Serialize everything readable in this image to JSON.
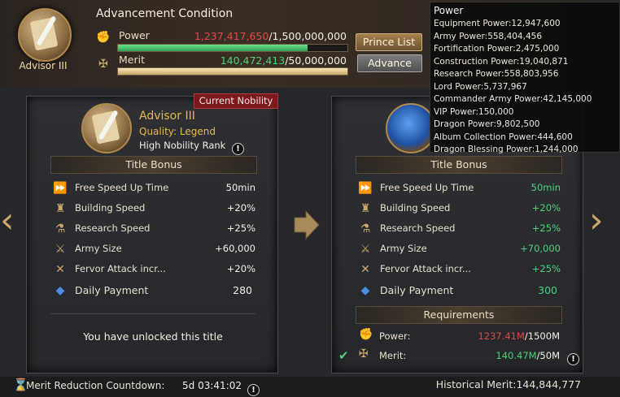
{
  "header": {
    "portrait_label": "Advisor III",
    "title": "Advancement Condition",
    "power": {
      "label": "Power",
      "current": "1,237,417,650",
      "required": "/1,500,000,000",
      "progress": 0.825
    },
    "merit": {
      "label": "Merit",
      "current": "140,472,413",
      "required": "/50,000,000",
      "progress": 1.0
    },
    "prince_list_button": "Prince List",
    "advance_button": "Advance"
  },
  "tooltip": {
    "title": "Power",
    "lines": [
      "Equipment Power:12,947,600",
      "Army Power:558,404,456",
      "Fortification Power:2,475,000",
      "Construction Power:19,040,871",
      "Research Power:558,803,956",
      "Lord Power:5,737,967",
      "Commander Army Power:42,145,000",
      "VIP Power:150,000",
      "Dragon Power:9,802,500",
      "Album Collection Power:444,600",
      "Dragon Blessing Power:1,244,000"
    ]
  },
  "left_card": {
    "badge": "Current Nobility",
    "name": "Advisor III",
    "quality": "Quality: Legend",
    "rank_note": "High Nobility Rank",
    "section_title": "Title Bonus",
    "bonuses": [
      {
        "icon": "speed-up-icon",
        "name": "Free Speed Up Time",
        "value": "50min"
      },
      {
        "icon": "building-icon",
        "name": "Building Speed",
        "value": "+20%"
      },
      {
        "icon": "research-icon",
        "name": "Research Speed",
        "value": "+25%"
      },
      {
        "icon": "army-icon",
        "name": "Army Size",
        "value": "+60,000"
      },
      {
        "icon": "swords-icon",
        "name": "Fervor Attack incr...",
        "value": "+20%"
      },
      {
        "icon": "gem-icon",
        "name": "Daily Payment",
        "value": "280"
      }
    ],
    "unlocked_text": "You have unlocked this title"
  },
  "right_card": {
    "section_title": "Title Bonus",
    "bonuses": [
      {
        "icon": "speed-up-icon",
        "name": "Free Speed Up Time",
        "value": "50min"
      },
      {
        "icon": "building-icon",
        "name": "Building Speed",
        "value": "+20%"
      },
      {
        "icon": "research-icon",
        "name": "Research Speed",
        "value": "+25%"
      },
      {
        "icon": "army-icon",
        "name": "Army Size",
        "value": "+70,000"
      },
      {
        "icon": "swords-icon",
        "name": "Fervor Attack incr...",
        "value": "+25%"
      },
      {
        "icon": "gem-icon",
        "name": "Daily Payment",
        "value": "300"
      }
    ],
    "requirements_title": "Requirements",
    "requirements": [
      {
        "label": "Power:",
        "current": "1237.41M",
        "required": "/1500M",
        "met": false
      },
      {
        "label": "Merit:",
        "current": "140.47M",
        "required": "/50M",
        "met": true
      }
    ]
  },
  "footer": {
    "countdown_label": "Merit Reduction Countdown:",
    "countdown_value": "5d 03:41:02",
    "historical": "Historical Merit:144,844,777"
  },
  "colors": {
    "red": "#e04848",
    "green": "#4fd07a",
    "gold": "#c9a86a",
    "badge": "#7a1a1f"
  }
}
